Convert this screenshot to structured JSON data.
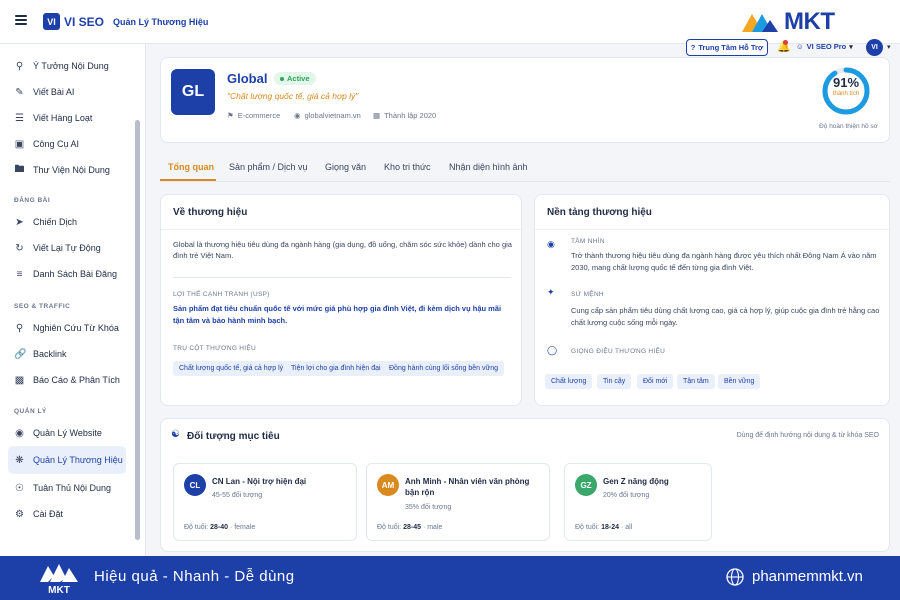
{
  "header": {
    "logo_mark": "VI",
    "logo_text": "VI SEO",
    "page_title": "Quản Lý Thương Hiệu",
    "brand_logo_text": "MKT",
    "support_label": "Trung Tâm Hỗ Trợ",
    "plan_label": "VI SEO Pro",
    "avatar_initials": "VI"
  },
  "sidebar": {
    "items": [
      {
        "label": "Ý Tưởng Nội Dung",
        "icon": "map-pin-icon"
      },
      {
        "label": "Viết Bài AI",
        "icon": "pen-icon"
      },
      {
        "label": "Viết Hàng Loạt",
        "icon": "layers-icon"
      },
      {
        "label": "Công Cụ AI",
        "icon": "chip-icon"
      },
      {
        "label": "Thư Viện Nội Dung",
        "icon": "folder-icon"
      },
      {
        "label": "Chiến Dịch",
        "icon": "send-icon"
      },
      {
        "label": "Viết Lại Tự Động",
        "icon": "refresh-icon"
      },
      {
        "label": "Danh Sách Bài Đăng",
        "icon": "list-icon"
      },
      {
        "label": "Nghiên Cứu Từ Khóa",
        "icon": "search-icon"
      },
      {
        "label": "Backlink",
        "icon": "link-icon"
      },
      {
        "label": "Báo Cáo & Phân Tích",
        "icon": "bar-chart-icon"
      },
      {
        "label": "Quản Lý Website",
        "icon": "globe-icon"
      },
      {
        "label": "Quản Lý Thương Hiệu",
        "icon": "palette-icon"
      },
      {
        "label": "Tuân Thủ Nội Dung",
        "icon": "shield-icon"
      },
      {
        "label": "Cài Đặt",
        "icon": "gear-icon"
      }
    ],
    "sections": {
      "dang_bai": "ĐĂNG BÀI",
      "seo_traffic": "SEO & TRAFFIC",
      "quan_ly": "QUẢN LÝ"
    }
  },
  "profile": {
    "logo_initials": "GL",
    "name": "Global",
    "status": "Active",
    "slogan": "\"Chất lượng quốc tế, giá cả hợp lý\"",
    "industry": "E-commerce",
    "website": "globalvietnam.vn",
    "founded": "Thành lập 2020",
    "completion_pct": "91%",
    "completion_value": 91,
    "completion_sub": "thành tích",
    "completion_label": "Độ hoàn thiện hồ sơ"
  },
  "tabs": [
    "Tổng quan",
    "Sản phẩm / Dịch vụ",
    "Giọng văn",
    "Kho tri thức",
    "Nhận diện hình ảnh"
  ],
  "about": {
    "title": "Về thương hiệu",
    "description": "Global là thương hiệu tiêu dùng đa ngành hàng (gia dụng, đồ uống, chăm sóc sức khỏe) dành cho gia đình trẻ Việt Nam.",
    "usp_heading": "LỢI THẾ CẠNH TRANH (USP)",
    "usp_text": "Sản phẩm đạt tiêu chuẩn quốc tế với mức giá phù hợp gia đình Việt, đi kèm dịch vụ hậu mãi tận tâm và bảo hành minh bạch.",
    "pillars_heading": "TRỤ CỘT THƯƠNG HIỆU",
    "pillars": [
      "Chất lượng quốc tế, giá cả hợp lý",
      "Tiện lợi cho gia đình hiện đại",
      "Đồng hành cùng lối sống bền vững"
    ]
  },
  "foundation": {
    "title": "Nền tảng thương hiệu",
    "vision_heading": "TẦM NHÌN",
    "vision_text": "Trở thành thương hiệu tiêu dùng đa ngành hàng được yêu thích nhất Đông Nam Á vào năm 2030, mang chất lượng quốc tế đến từng gia đình Việt.",
    "mission_heading": "SỨ MỆNH",
    "mission_text": "Cung cấp sản phẩm tiêu dùng chất lượng cao, giá cả hợp lý, giúp cuộc gia đình trẻ hằng cao chất lượng cuộc sống mỗi ngày.",
    "tone_heading": "GIỌNG ĐIỆU THƯƠNG HIỆU",
    "tones": [
      "Chất lượng",
      "Tin cậy",
      "Đổi mới",
      "Tận tâm",
      "Bền vững"
    ]
  },
  "audience": {
    "title": "Đối tượng mục tiêu",
    "hint": "Dùng để định hướng nội dung & từ khóa SEO",
    "personas": [
      {
        "initials": "CL",
        "color": "#1d3fa8",
        "name": "CN Lan - Nội trợ hiện đại",
        "sub": "45-55 đối tượng",
        "age_label": "Độ tuổi:",
        "age": "28-40",
        "gender": "· female"
      },
      {
        "initials": "AM",
        "color": "#d98a1f",
        "name": "Anh Minh - Nhân viên văn phòng bận rộn",
        "sub": "35% đối tượng",
        "age_label": "Độ tuổi:",
        "age": "28-45",
        "gender": "· male"
      },
      {
        "initials": "GZ",
        "color": "#3aa86a",
        "name": "Gen Z năng động",
        "sub": "20% đối tượng",
        "age_label": "Độ tuổi:",
        "age": "18-24",
        "gender": "· all"
      }
    ]
  },
  "footer": {
    "slogan": "Hiệu quả - Nhanh - Dễ dùng",
    "url": "phanmemmkt.vn",
    "logo_text": "MKT"
  },
  "colors": {
    "primary": "#1d3fa8",
    "accent": "#d98a1f",
    "success": "#2fa45c",
    "background": "#f3f5f9"
  }
}
